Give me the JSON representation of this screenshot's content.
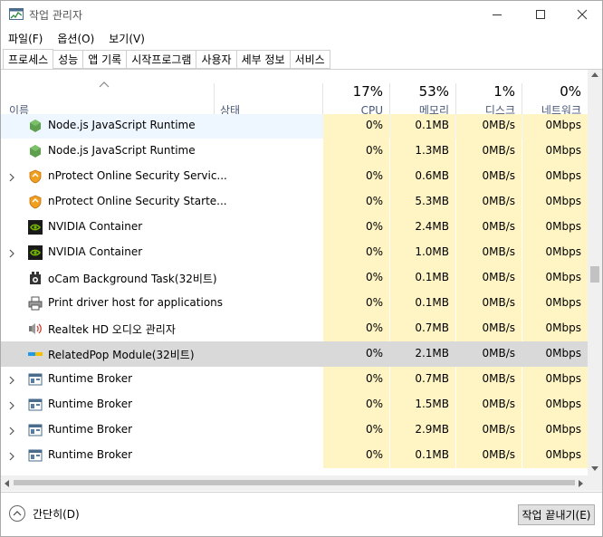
{
  "window": {
    "title": "작업 관리자"
  },
  "menu": [
    {
      "label": "파일(F)"
    },
    {
      "label": "옵션(O)"
    },
    {
      "label": "보기(V)"
    }
  ],
  "tabs": [
    {
      "label": "프로세스",
      "active": true
    },
    {
      "label": "성능"
    },
    {
      "label": "앱 기록"
    },
    {
      "label": "시작프로그램"
    },
    {
      "label": "사용자"
    },
    {
      "label": "세부 정보"
    },
    {
      "label": "서비스"
    }
  ],
  "columns": {
    "name": "이름",
    "status": "상태",
    "cpu": {
      "pct": "17%",
      "label": "CPU"
    },
    "memory": {
      "pct": "53%",
      "label": "메모리"
    },
    "disk": {
      "pct": "1%",
      "label": "디스크"
    },
    "network": {
      "pct": "0%",
      "label": "네트워크"
    }
  },
  "colors": {
    "heat": "#fff4c4",
    "selected": "#d9d9d9",
    "header_text": "#4a5a7a"
  },
  "rows": [
    {
      "name": "Node.js JavaScript Runtime",
      "icon": "nodejs-icon",
      "expandable": false,
      "cpu": "0%",
      "mem": "0.1MB",
      "disk": "0MB/s",
      "net": "0Mbps"
    },
    {
      "name": "Node.js JavaScript Runtime",
      "icon": "nodejs-icon",
      "expandable": false,
      "cpu": "0%",
      "mem": "1.3MB",
      "disk": "0MB/s",
      "net": "0Mbps"
    },
    {
      "name": "nProtect Online Security Servic...",
      "icon": "nprotect-shield-icon",
      "expandable": true,
      "cpu": "0%",
      "mem": "0.6MB",
      "disk": "0MB/s",
      "net": "0Mbps"
    },
    {
      "name": "nProtect Online Security Starte...",
      "icon": "nprotect-shield-icon",
      "expandable": false,
      "cpu": "0%",
      "mem": "5.3MB",
      "disk": "0MB/s",
      "net": "0Mbps"
    },
    {
      "name": "NVIDIA Container",
      "icon": "nvidia-icon",
      "expandable": false,
      "cpu": "0%",
      "mem": "2.4MB",
      "disk": "0MB/s",
      "net": "0Mbps"
    },
    {
      "name": "NVIDIA Container",
      "icon": "nvidia-icon",
      "expandable": true,
      "cpu": "0%",
      "mem": "1.0MB",
      "disk": "0MB/s",
      "net": "0Mbps"
    },
    {
      "name": "oCam Background Task(32비트)",
      "icon": "ocam-icon",
      "expandable": false,
      "cpu": "0%",
      "mem": "0.1MB",
      "disk": "0MB/s",
      "net": "0Mbps"
    },
    {
      "name": "Print driver host for applications",
      "icon": "printer-icon",
      "expandable": false,
      "cpu": "0%",
      "mem": "0.1MB",
      "disk": "0MB/s",
      "net": "0Mbps"
    },
    {
      "name": "Realtek HD 오디오 관리자",
      "icon": "speaker-icon",
      "expandable": false,
      "cpu": "0%",
      "mem": "0.7MB",
      "disk": "0MB/s",
      "net": "0Mbps"
    },
    {
      "name": "RelatedPop Module(32비트)",
      "icon": "relatedpop-icon",
      "expandable": false,
      "selected": true,
      "cpu": "0%",
      "mem": "2.1MB",
      "disk": "0MB/s",
      "net": "0Mbps"
    },
    {
      "name": "Runtime Broker",
      "icon": "runtime-broker-icon",
      "expandable": true,
      "cpu": "0%",
      "mem": "0.7MB",
      "disk": "0MB/s",
      "net": "0Mbps"
    },
    {
      "name": "Runtime Broker",
      "icon": "runtime-broker-icon",
      "expandable": true,
      "cpu": "0%",
      "mem": "1.5MB",
      "disk": "0MB/s",
      "net": "0Mbps"
    },
    {
      "name": "Runtime Broker",
      "icon": "runtime-broker-icon",
      "expandable": true,
      "cpu": "0%",
      "mem": "2.9MB",
      "disk": "0MB/s",
      "net": "0Mbps"
    },
    {
      "name": "Runtime Broker",
      "icon": "runtime-broker-icon",
      "expandable": true,
      "cpu": "0%",
      "mem": "0.1MB",
      "disk": "0MB/s",
      "net": "0Mbps"
    }
  ],
  "footer": {
    "fewer_details": "간단히(D)",
    "end_task": "작업 끝내기(E)"
  }
}
